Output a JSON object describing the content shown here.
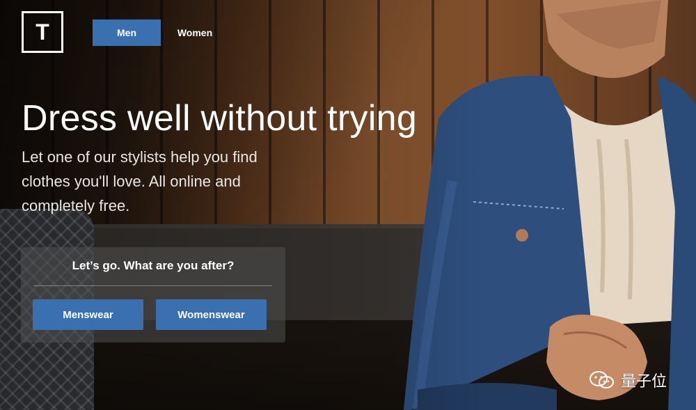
{
  "logo": {
    "letter": "T"
  },
  "nav": {
    "tabs": [
      {
        "label": "Men",
        "active": true
      },
      {
        "label": "Women",
        "active": false
      }
    ]
  },
  "hero": {
    "headline": "Dress well without trying",
    "subcopy": "Let one of our stylists help you find clothes you'll love. All online and completely free."
  },
  "card": {
    "question": "Let’s go. What are you after?",
    "buttons": {
      "menswear": "Menswear",
      "womenswear": "Womenswear"
    }
  },
  "watermark": {
    "text": "量子位",
    "icon": "wechat-icon"
  },
  "colors": {
    "accent": "#3a6fb0",
    "text": "#ffffff"
  }
}
